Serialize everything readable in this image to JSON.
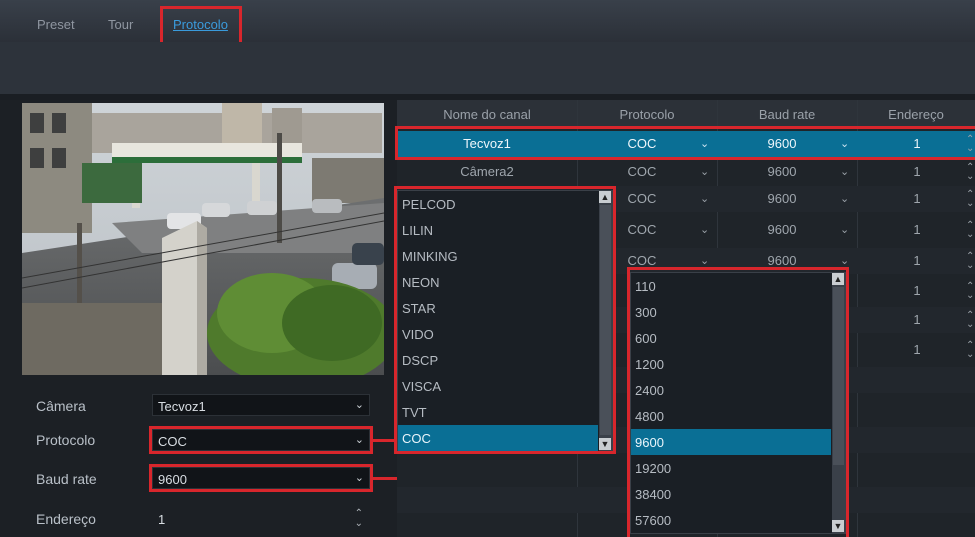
{
  "tabs": [
    {
      "label": "Preset"
    },
    {
      "label": "Tour"
    },
    {
      "label": "Protocolo"
    }
  ],
  "form": {
    "camera": {
      "label": "Câmera",
      "value": "Tecvoz1"
    },
    "protocol": {
      "label": "Protocolo",
      "value": "COC"
    },
    "baud_rate": {
      "label": "Baud rate",
      "value": "9600"
    },
    "address": {
      "label": "Endereço",
      "value": "1"
    }
  },
  "table": {
    "headers": [
      "Nome do canal",
      "Protocolo",
      "Baud rate",
      "Endereço"
    ],
    "rows": [
      {
        "name": "Tecvoz1",
        "protocol": "COC",
        "baud": "9600",
        "address": "1"
      },
      {
        "name": "Câmera2",
        "protocol": "COC",
        "baud": "9600",
        "address": "1"
      },
      {
        "name": "",
        "protocol": "COC",
        "baud": "9600",
        "address": "1"
      },
      {
        "name": "",
        "protocol": "COC",
        "baud": "9600",
        "address": "1"
      },
      {
        "name": "",
        "protocol": "COC",
        "baud": "9600",
        "address": "1"
      },
      {
        "name": "",
        "protocol": "",
        "baud": "",
        "address": "1"
      },
      {
        "name": "",
        "protocol": "",
        "baud": "",
        "address": "1"
      },
      {
        "name": "",
        "protocol": "",
        "baud": "",
        "address": "1"
      }
    ]
  },
  "protocol_options": [
    "PELCOD",
    "LILIN",
    "MINKING",
    "NEON",
    "STAR",
    "VIDO",
    "DSCP",
    "VISCA",
    "TVT",
    "COC"
  ],
  "protocol_selected": "COC",
  "baud_options": [
    "110",
    "300",
    "600",
    "1200",
    "2400",
    "4800",
    "9600",
    "19200",
    "38400",
    "57600"
  ],
  "baud_selected": "9600",
  "colors": {
    "highlight": "#d8262c",
    "selection": "#0a6f95",
    "accent": "#3a9bdc"
  }
}
